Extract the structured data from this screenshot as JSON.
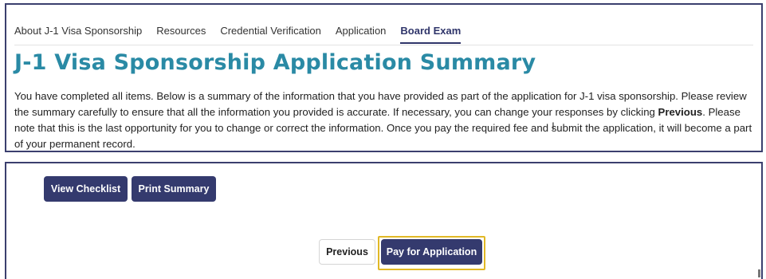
{
  "tabs": [
    {
      "label": "About J-1 Visa Sponsorship",
      "active": false
    },
    {
      "label": "Resources",
      "active": false
    },
    {
      "label": "Credential Verification",
      "active": false
    },
    {
      "label": "Application",
      "active": false
    },
    {
      "label": "Board Exam",
      "active": true
    }
  ],
  "page_title": "J-1 Visa Sponsorship Application Summary",
  "intro": {
    "part1": "You have completed all items. Below is a summary of the information that you have provided as part of the application for J-1 visa sponsorship. Please review the summary carefully to ensure that all the information you provided is accurate. If necessary, you can change your responses by clicking ",
    "bold": "Previous",
    "part2": ". Please note that this is the last opportunity for you to change or correct the information. Once you pay the required fee and submit the application, it will become a part of your permanent record."
  },
  "buttons": {
    "view_checklist": "View Checklist",
    "print_summary": "Print Summary",
    "previous": "Previous",
    "pay": "Pay for Application"
  },
  "colors": {
    "title": "#2a8aa5",
    "primary_button": "#343a6e",
    "focus_ring": "#e1b826",
    "panel_border": "#3b3f6e"
  },
  "icons": {
    "cursor": "text-cursor-icon"
  }
}
